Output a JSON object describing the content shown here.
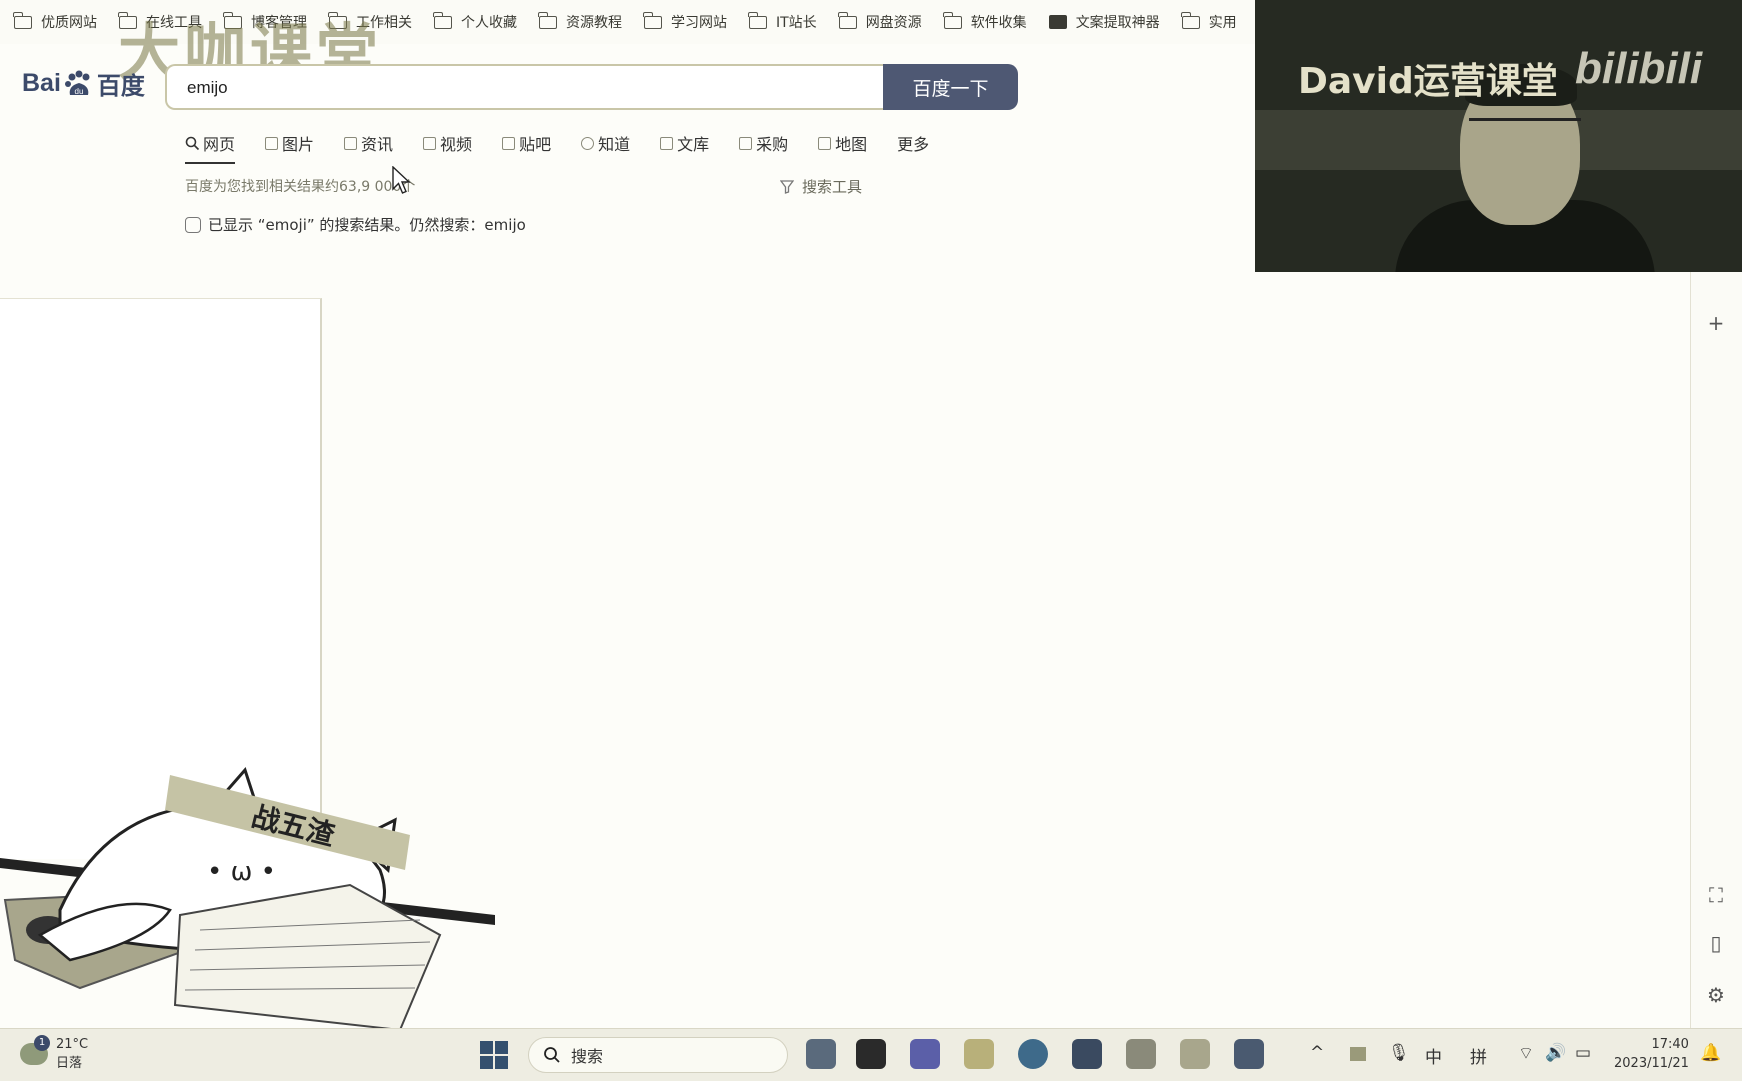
{
  "bookmarks": [
    "优质网站",
    "在线工具",
    "博客管理",
    "工作相关",
    "个人收藏",
    "资源教程",
    "学习网站",
    "IT站长",
    "网盘资源",
    "软件收集",
    "文案提取神器",
    "实用"
  ],
  "watermark": "大咖课堂",
  "logo": {
    "bai": "Bai",
    "paw_text": "du",
    "cn": "百度"
  },
  "search": {
    "query": "emijo",
    "button": "百度一下"
  },
  "tabs": [
    {
      "icon": "search-icon",
      "label": "网页"
    },
    {
      "icon": "image-icon",
      "label": "图片"
    },
    {
      "icon": "news-icon",
      "label": "资讯"
    },
    {
      "icon": "video-icon",
      "label": "视频"
    },
    {
      "icon": "tieba-icon",
      "label": "贴吧"
    },
    {
      "icon": "question-icon",
      "label": "知道"
    },
    {
      "icon": "doc-icon",
      "label": "文库"
    },
    {
      "icon": "shop-icon",
      "label": "采购"
    },
    {
      "icon": "map-icon",
      "label": "地图"
    },
    {
      "icon": "",
      "label": "更多"
    }
  ],
  "results": {
    "count": "百度为您找到相关结果约63,9  000个",
    "tools": "搜索工具",
    "notice": "已显示 “emoji” 的搜索结果。仍然搜索：emijo"
  },
  "webcam": {
    "title": "David运营课堂",
    "brand": "bilibili"
  },
  "cat": {
    "headband": "战五渣"
  },
  "taskbar": {
    "weather_temp": "21°C",
    "weather_text": "日落",
    "weather_badge": "1",
    "search_label": "搜索",
    "tray_ime1": "中",
    "tray_ime2": "拼",
    "time": "17:40",
    "date": "2023/11/21"
  },
  "colors": {
    "accent": "#4e5873",
    "logo": "#3c4a6a",
    "watermark": "#787646"
  }
}
